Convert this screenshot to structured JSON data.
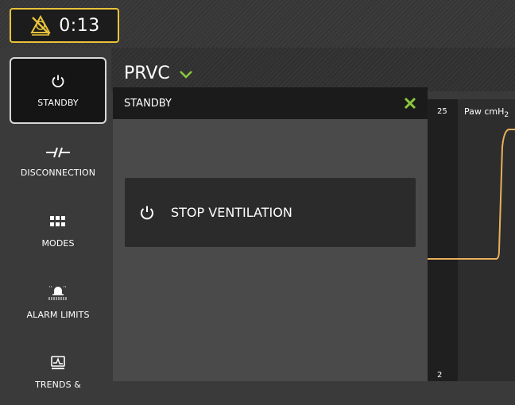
{
  "alarm": {
    "timer": "0:13",
    "icon": "alarm-silenced-icon",
    "border_color": "#e9c33a"
  },
  "mode": {
    "name": "PRVC",
    "icon": "chevron-down-icon",
    "accent": "#8dc63f"
  },
  "sidebar": {
    "items": [
      {
        "label": "STANDBY",
        "icon": "power-icon",
        "active": true
      },
      {
        "label": "DISCONNECTION",
        "icon": "disconnection-icon",
        "active": false
      },
      {
        "label": "MODES",
        "icon": "grid-icon",
        "active": false
      },
      {
        "label": "ALARM LIMITS",
        "icon": "alarm-bell-icon",
        "active": false
      },
      {
        "label": "TRENDS &",
        "icon": "trends-icon",
        "active": false
      }
    ]
  },
  "dialog": {
    "title": "STANDBY",
    "close_icon": "close-icon",
    "close_color": "#8dc63f",
    "stop_button_label": "STOP VENTILATION",
    "stop_icon": "power-icon"
  },
  "graph": {
    "param": "Paw cmH",
    "param_sub": "2",
    "y_max": "25",
    "y_min": "2",
    "trace_color": "#e8b05a"
  }
}
